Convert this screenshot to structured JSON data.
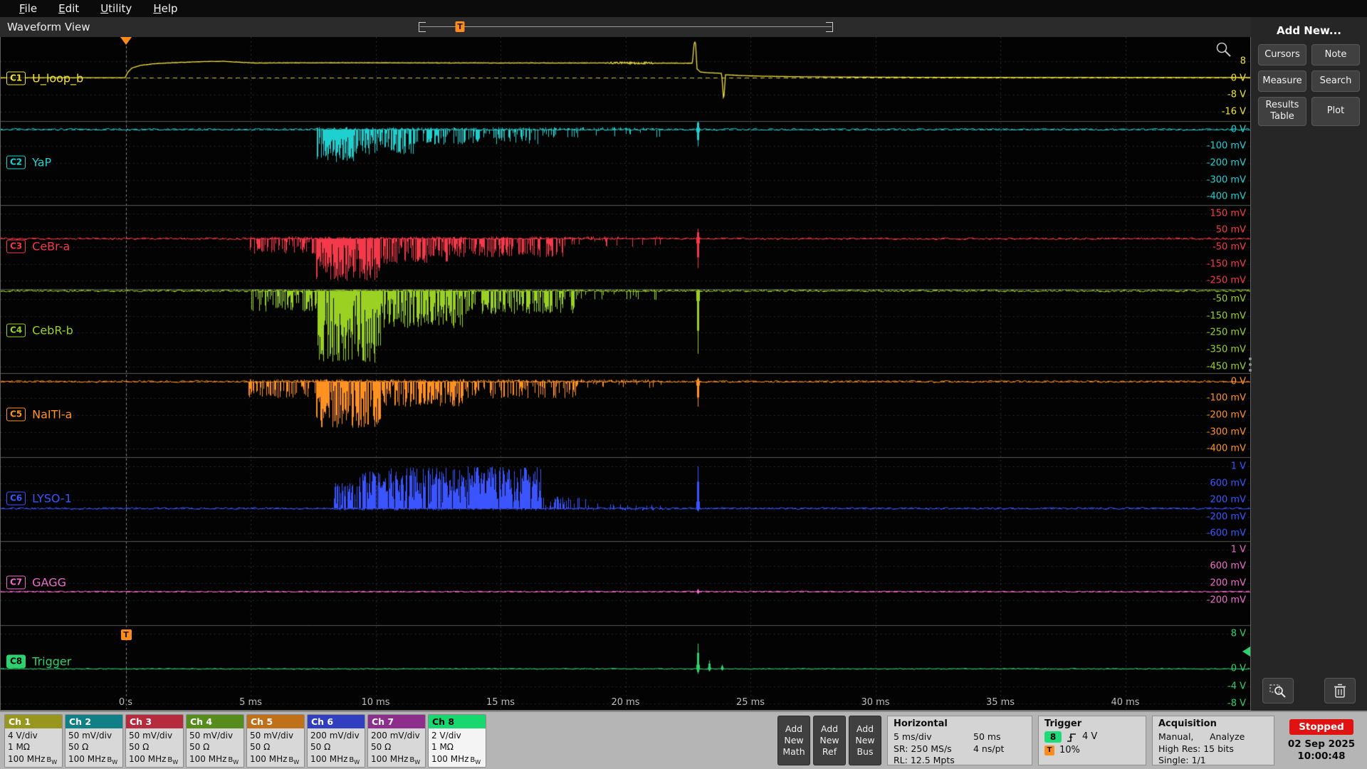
{
  "menu": {
    "items": [
      "File",
      "Edit",
      "Utility",
      "Help"
    ]
  },
  "view": {
    "title": "Waveform View"
  },
  "overview_bar": {
    "trigger_marker": "T",
    "position_frac": 0.1
  },
  "accent_colors": {
    "trigger_orange": "#ff8c1a",
    "stopped_red": "#e01212",
    "selected_green": "#1ddc78"
  },
  "plot": {
    "time_labels": [
      "0 s",
      "5 ms",
      "10 ms",
      "15 ms",
      "20 ms",
      "25 ms",
      "30 ms",
      "35 ms",
      "40 ms"
    ],
    "trigger_frac": 0.1,
    "trigger_source_marker": "T",
    "trigger_level_channel": "C8",
    "trigger_level_frac": 0.31,
    "channels": [
      {
        "id": "C1",
        "name": "U_loop_b",
        "color": "#f2e13c",
        "label_frac": 0.49,
        "baseline": 0.484,
        "type": "pulse",
        "scale_labels": [
          [
            "8",
            0.29
          ],
          [
            "0 V",
            0.49
          ],
          [
            "-8 V",
            0.69
          ],
          [
            "-16 V",
            0.89
          ]
        ],
        "frac_per_volt": 0.025,
        "points": [
          [
            -5,
            0
          ],
          [
            -0.02,
            0
          ],
          [
            0.08,
            2.5
          ],
          [
            0.25,
            4.6
          ],
          [
            0.6,
            5.9
          ],
          [
            1.2,
            6.7
          ],
          [
            2.2,
            7.3
          ],
          [
            3.2,
            7.7
          ],
          [
            3.9,
            7.8
          ],
          [
            4.5,
            7.4
          ],
          [
            5.2,
            7.0
          ],
          [
            6.5,
            7.05
          ],
          [
            9,
            7.1
          ],
          [
            12,
            7.05
          ],
          [
            15,
            7.0
          ],
          [
            18,
            7.0
          ],
          [
            19,
            7.0
          ],
          [
            21,
            6.95
          ],
          [
            22.4,
            6.9
          ],
          [
            22.68,
            6.9
          ],
          [
            22.74,
            16
          ],
          [
            22.8,
            17.5
          ],
          [
            22.86,
            4.2
          ],
          [
            23.0,
            2.7
          ],
          [
            23.3,
            2.35
          ],
          [
            23.85,
            2.1
          ],
          [
            23.93,
            -11.5
          ],
          [
            24.0,
            1.4
          ],
          [
            24.5,
            1.1
          ],
          [
            25.5,
            0.7
          ],
          [
            27,
            0.45
          ],
          [
            29,
            0.28
          ],
          [
            32,
            0.17
          ],
          [
            36,
            0.12
          ],
          [
            45,
            0.1
          ]
        ],
        "noise_segs": [
          [
            0.6,
            18.9,
            0.07
          ],
          [
            19.2,
            21.1,
            0.5
          ],
          [
            21.1,
            22.5,
            0.09
          ],
          [
            24.3,
            45,
            0.035
          ]
        ]
      },
      {
        "id": "C2",
        "name": "YaP",
        "color": "#1fd0d0",
        "label_frac": 0.49,
        "baseline": 0.1,
        "type": "burst",
        "dir": 1,
        "scale_labels": [
          [
            "0 V",
            0.1
          ],
          [
            "-100 mV",
            0.3
          ],
          [
            "-200 mV",
            0.5
          ],
          [
            "-300 mV",
            0.7
          ],
          [
            "-400 mV",
            0.9
          ]
        ],
        "bursts": [
          [
            7.6,
            9.2,
            0.4,
            0.95
          ],
          [
            9.2,
            11.5,
            0.3,
            0.75
          ],
          [
            11.5,
            16.5,
            0.18,
            0.45
          ],
          [
            16.5,
            21.5,
            0.1,
            0.12
          ]
        ],
        "spikes": [
          [
            22.9,
            0.2,
            0.13
          ]
        ],
        "base_noise": 0.012
      },
      {
        "id": "C3",
        "name": "CeBr-a",
        "color": "#f4394b",
        "label_frac": 0.49,
        "baseline": 0.4,
        "type": "burst",
        "dir": 1,
        "scale_labels": [
          [
            "150 mV",
            0.1
          ],
          [
            "50 mV",
            0.3
          ],
          [
            "-50 mV",
            0.5
          ],
          [
            "-150 mV",
            0.7
          ],
          [
            "-250 mV",
            0.9
          ]
        ],
        "bursts": [
          [
            4.9,
            7.6,
            0.18,
            0.55
          ],
          [
            7.6,
            10.2,
            0.5,
            0.95
          ],
          [
            10.2,
            13,
            0.3,
            0.7
          ],
          [
            13,
            17.5,
            0.22,
            0.5
          ],
          [
            17.5,
            21.5,
            0.1,
            0.1
          ]
        ],
        "spikes": [
          [
            22.9,
            0.35,
            0.12
          ]
        ],
        "base_noise": 0.012
      },
      {
        "id": "C4",
        "name": "CebR-b",
        "color": "#9ad122",
        "label_frac": 0.49,
        "baseline": 0.02,
        "type": "burst",
        "dir": 1,
        "scale_labels": [
          [
            "-50 mV",
            0.12
          ],
          [
            "-150 mV",
            0.32
          ],
          [
            "-250 mV",
            0.52
          ],
          [
            "-350 mV",
            0.72
          ],
          [
            "-450 mV",
            0.92
          ]
        ],
        "bursts": [
          [
            4.9,
            7.6,
            0.25,
            0.6
          ],
          [
            7.6,
            10.2,
            0.88,
            0.95
          ],
          [
            10.2,
            13.5,
            0.45,
            0.8
          ],
          [
            13.5,
            18,
            0.28,
            0.55
          ],
          [
            18,
            21.5,
            0.12,
            0.12
          ]
        ],
        "spikes": [
          [
            22.9,
            0.75,
            0.03
          ]
        ],
        "base_noise": 0.015
      },
      {
        "id": "C5",
        "name": "NaITl-a",
        "color": "#ff9220",
        "label_frac": 0.49,
        "baseline": 0.1,
        "type": "burst",
        "dir": 1,
        "scale_labels": [
          [
            "0 V",
            0.1
          ],
          [
            "-100 mV",
            0.3
          ],
          [
            "-200 mV",
            0.5
          ],
          [
            "-300 mV",
            0.7
          ],
          [
            "-400 mV",
            0.9
          ]
        ],
        "bursts": [
          [
            4.9,
            7.6,
            0.2,
            0.5
          ],
          [
            7.6,
            10.2,
            0.55,
            0.9
          ],
          [
            10.2,
            13.5,
            0.3,
            0.7
          ],
          [
            13.5,
            18,
            0.2,
            0.45
          ],
          [
            18,
            21.5,
            0.08,
            0.1
          ]
        ],
        "spikes": [
          [
            22.9,
            0.3,
            0.05
          ]
        ],
        "base_noise": 0.012
      },
      {
        "id": "C6",
        "name": "LYSO-1",
        "color": "#3a55ff",
        "label_frac": 0.49,
        "baseline": 0.61,
        "type": "burst",
        "dir": -1,
        "scale_labels": [
          [
            "1 V",
            0.11
          ],
          [
            "600 mV",
            0.31
          ],
          [
            "200 mV",
            0.51
          ],
          [
            "-200 mV",
            0.71
          ],
          [
            "-600 mV",
            0.91
          ]
        ],
        "bursts": [
          [
            8.3,
            9.3,
            0.3,
            0.7
          ],
          [
            9.3,
            10.5,
            0.45,
            0.85
          ],
          [
            10.5,
            16.6,
            0.5,
            0.92
          ],
          [
            16.6,
            18.5,
            0.15,
            0.35
          ],
          [
            18.5,
            21.5,
            0.06,
            0.1
          ]
        ],
        "spikes": [
          [
            22.9,
            0.5,
            0.04
          ]
        ],
        "base_noise": 0.012
      },
      {
        "id": "C7",
        "name": "GAGG",
        "color": "#ef6cc9",
        "label_frac": 0.49,
        "baseline": 0.6,
        "type": "burst",
        "dir": 1,
        "scale_labels": [
          [
            "1 V",
            0.1
          ],
          [
            "600 mV",
            0.3
          ],
          [
            "200 mV",
            0.5
          ],
          [
            "-200 mV",
            0.7
          ]
        ],
        "bursts": [],
        "spikes": [
          [
            22.9,
            0.03,
            0.03
          ]
        ],
        "base_noise": 0.006
      },
      {
        "id": "C8",
        "name": "Trigger",
        "color": "#2fd06e",
        "label_frac": 0.43,
        "baseline": 0.52,
        "type": "burst",
        "dir": -1,
        "scale_labels": [
          [
            "8 V",
            0.1
          ],
          [
            "0 V",
            0.52
          ],
          [
            "-4 V",
            0.73
          ],
          [
            "-8 V",
            0.93
          ]
        ],
        "bursts": [],
        "spikes": [
          [
            22.9,
            0.3,
            0.06
          ],
          [
            23.35,
            0.1,
            0.03
          ],
          [
            23.85,
            0.05,
            0.02
          ]
        ],
        "base_noise": 0.006
      }
    ]
  },
  "right_panel": {
    "title": "Add New...",
    "buttons": [
      "Cursors",
      "Note",
      "Measure",
      "Search",
      "Results Table",
      "Plot"
    ]
  },
  "bottom": {
    "channels": [
      {
        "label": "Ch 1",
        "vdiv": "4 V/div",
        "imp": "1 MΩ",
        "bw": "100 MHz",
        "bw_tag": "BW",
        "color": "#97971f",
        "selected": false
      },
      {
        "label": "Ch 2",
        "vdiv": "50 mV/div",
        "imp": "50 Ω",
        "bw": "100 MHz",
        "bw_tag": "BW",
        "color": "#107f86",
        "selected": false
      },
      {
        "label": "Ch 3",
        "vdiv": "50 mV/div",
        "imp": "50 Ω",
        "bw": "100 MHz",
        "bw_tag": "BW",
        "color": "#b52b3d",
        "selected": false
      },
      {
        "label": "Ch 4",
        "vdiv": "50 mV/div",
        "imp": "50 Ω",
        "bw": "100 MHz",
        "bw_tag": "BW",
        "color": "#568c1c",
        "selected": false
      },
      {
        "label": "Ch 5",
        "vdiv": "50 mV/div",
        "imp": "50 Ω",
        "bw": "100 MHz",
        "bw_tag": "BW",
        "color": "#c07018",
        "selected": false
      },
      {
        "label": "Ch 6",
        "vdiv": "200 mV/div",
        "imp": "50 Ω",
        "bw": "100 MHz",
        "bw_tag": "BW",
        "color": "#2f3fbf",
        "selected": false
      },
      {
        "label": "Ch 7",
        "vdiv": "200 mV/div",
        "imp": "50 Ω",
        "bw": "100 MHz",
        "bw_tag": "BW",
        "color": "#8c2f8c",
        "selected": false
      },
      {
        "label": "Ch 8",
        "vdiv": "2 V/div",
        "imp": "1 MΩ",
        "bw": "100 MHz",
        "bw_tag": "BW",
        "color": "#17d86e",
        "selected": true
      }
    ],
    "add_buttons": [
      [
        "Add",
        "New",
        "Math"
      ],
      [
        "Add",
        "New",
        "Ref"
      ],
      [
        "Add",
        "New",
        "Bus"
      ]
    ],
    "horizontal": {
      "title": "Horizontal",
      "scale": "5 ms/div",
      "window": "50 ms",
      "sr": "SR: 250 MS/s",
      "res": "4 ns/pt",
      "rl": "RL: 12.5 Mpts"
    },
    "trigger": {
      "title": "Trigger",
      "source": "8",
      "level": "4 V",
      "marker": "T",
      "position": "10%"
    },
    "acquisition": {
      "title": "Acquisition",
      "mode": "Manual,",
      "analyze": "Analyze",
      "highres": "High Res: 15 bits",
      "single": "Single: 1/1"
    },
    "status": {
      "state": "Stopped",
      "date": "02 Sep 2025",
      "time": "10:00:48"
    }
  }
}
